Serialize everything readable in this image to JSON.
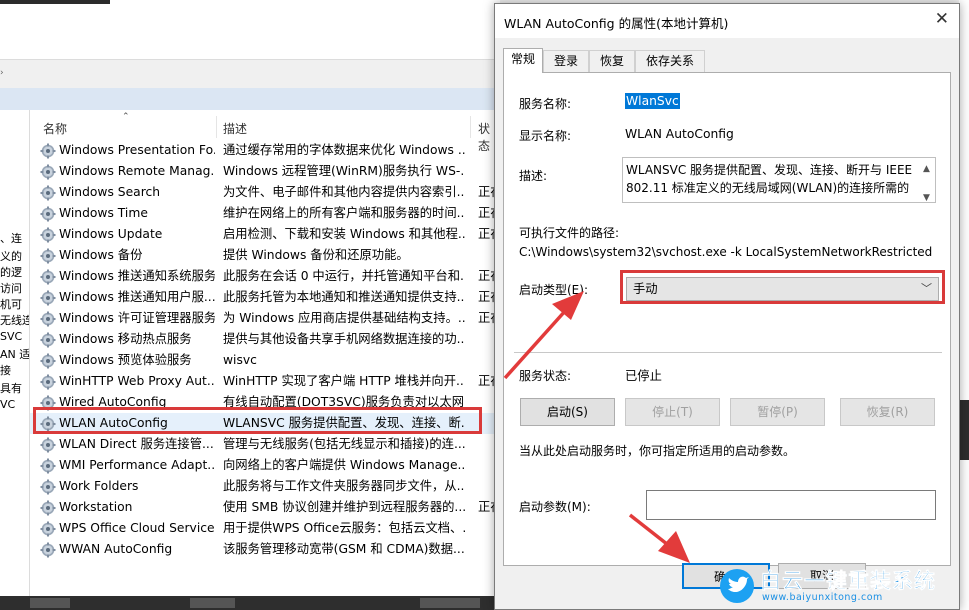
{
  "services_list": {
    "columns": {
      "name": "名称",
      "description": "描述",
      "status": "状态"
    },
    "left_pane_fragments": [
      "、连",
      "义的",
      "的逻",
      "访问",
      "机可",
      "无线连",
      "SVC",
      "AN 适",
      "接",
      "具有",
      "VC"
    ],
    "rows": [
      {
        "name": "Windows Presentation Fo...",
        "description": "通过缓存常用的字体数据来优化 Windows ...",
        "status": ""
      },
      {
        "name": "Windows Remote Manag...",
        "description": "Windows 远程管理(WinRM)服务执行 WS-...",
        "status": ""
      },
      {
        "name": "Windows Search",
        "description": "为文件、电子邮件和其他内容提供内容索引...",
        "status": "正在"
      },
      {
        "name": "Windows Time",
        "description": "维护在网络上的所有客户端和服务器的时间...",
        "status": "正在"
      },
      {
        "name": "Windows Update",
        "description": "启用检测、下载和安装 Windows 和其他程...",
        "status": "正在"
      },
      {
        "name": "Windows 备份",
        "description": "提供 Windows 备份和还原功能。",
        "status": ""
      },
      {
        "name": "Windows 推送通知系统服务",
        "description": "此服务在会话 0 中运行，并托管通知平台和...",
        "status": "正在"
      },
      {
        "name": "Windows 推送通知用户服...",
        "description": "此服务托管为本地通知和推送通知提供支持...",
        "status": "正在"
      },
      {
        "name": "Windows 许可证管理器服务",
        "description": "为 Windows 应用商店提供基础结构支持。...",
        "status": "正在"
      },
      {
        "name": "Windows 移动热点服务",
        "description": "提供与其他设备共享手机网络数据连接的功...",
        "status": ""
      },
      {
        "name": "Windows 预览体验服务",
        "description": "wisvc",
        "status": ""
      },
      {
        "name": "WinHTTP Web Proxy Aut...",
        "description": "WinHTTP 实现了客户端 HTTP 堆栈并向开...",
        "status": "正在"
      },
      {
        "name": "Wired AutoConfig",
        "description": "有线自动配置(DOT3SVC)服务负责对以太网...",
        "status": ""
      },
      {
        "name": "WLAN AutoConfig",
        "description": "WLANSVC 服务提供配置、发现、连接、断...",
        "status": ""
      },
      {
        "name": "WLAN Direct 服务连接管...",
        "description": "管理与无线服务(包括无线显示和插接)的连...",
        "status": ""
      },
      {
        "name": "WMI Performance Adapt...",
        "description": "向网络上的客户端提供 Windows Manage...",
        "status": ""
      },
      {
        "name": "Work Folders",
        "description": "此服务将与工作文件夹服务器同步文件，从...",
        "status": ""
      },
      {
        "name": "Workstation",
        "description": "使用 SMB 协议创建并维护到远程服务器的...",
        "status": "正在"
      },
      {
        "name": "WPS Office Cloud Service",
        "description": "用于提供WPS Office云服务：包括云文档、...",
        "status": ""
      },
      {
        "name": "WWAN AutoConfig",
        "description": "该服务管理移动宽带(GSM 和 CDMA)数据...",
        "status": ""
      }
    ]
  },
  "dialog": {
    "title": "WLAN AutoConfig 的属性(本地计算机)",
    "close_glyph": "✕",
    "tabs": [
      "常规",
      "登录",
      "恢复",
      "依存关系"
    ],
    "service_name_label": "服务名称:",
    "service_name": "WlanSvc",
    "display_name_label": "显示名称:",
    "display_name": "WLAN AutoConfig",
    "description_label": "描述:",
    "description_line1": "WLANSVC 服务提供配置、发现、连接、断开与 IEEE",
    "description_line2": "802.11 标准定义的无线局域网(WLAN)的连接所需的",
    "exec_path_label": "可执行文件的路径:",
    "exec_path": "C:\\Windows\\system32\\svchost.exe -k LocalSystemNetworkRestricted",
    "startup_type_label": "启动类型(E):",
    "startup_type": "手动",
    "service_status_label": "服务状态:",
    "service_status": "已停止",
    "buttons": {
      "start": "启动(S)",
      "stop": "停止(T)",
      "pause": "暂停(P)",
      "resume": "恢复(R)"
    },
    "hint": "当从此处启动服务时，你可指定所适用的启动参数。",
    "start_params_label": "启动参数(M):",
    "ok_label": "确定",
    "cancel_label": "取消"
  },
  "watermark": {
    "title": "白云一键重装系统",
    "url": "www.baiyunxitong.com"
  },
  "colors": {
    "highlight_red": "#d93a3a",
    "selection_blue": "#0078d7",
    "watermark_blue": "#1a8fe3"
  }
}
